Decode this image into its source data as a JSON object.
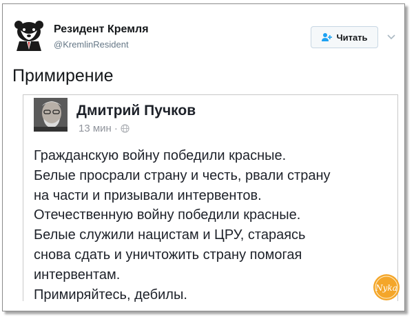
{
  "author": {
    "name": "Резидент Кремля",
    "handle": "@KremlinResident",
    "avatar_icon": "bear-logo-icon"
  },
  "follow_button": {
    "label": "Читать",
    "icon": "follow-user-icon"
  },
  "menu_icon": "chevron-down-icon",
  "tweet": {
    "text": "Примирение"
  },
  "embedded_post": {
    "author_name": "Дмитрий Пучков",
    "time": "13 мин",
    "separator": "·",
    "privacy_icon": "globe-icon",
    "lines": [
      "Гражданскую войну победили красные.",
      "Белые просрали страну и честь, рвали страну",
      "на части и призывали интервентов.",
      "Отечественную войну победили красные.",
      "Белые служили нацистам и ЦРУ, стараясь",
      "снова сдать и уничтожить страну помогая",
      "интервентам.",
      "Примиряйтесь, дебилы."
    ]
  },
  "watermark": {
    "text": "Nyka",
    "color": "#f0a020"
  },
  "colors": {
    "accent": "#1da1f2",
    "muted": "#657786"
  }
}
